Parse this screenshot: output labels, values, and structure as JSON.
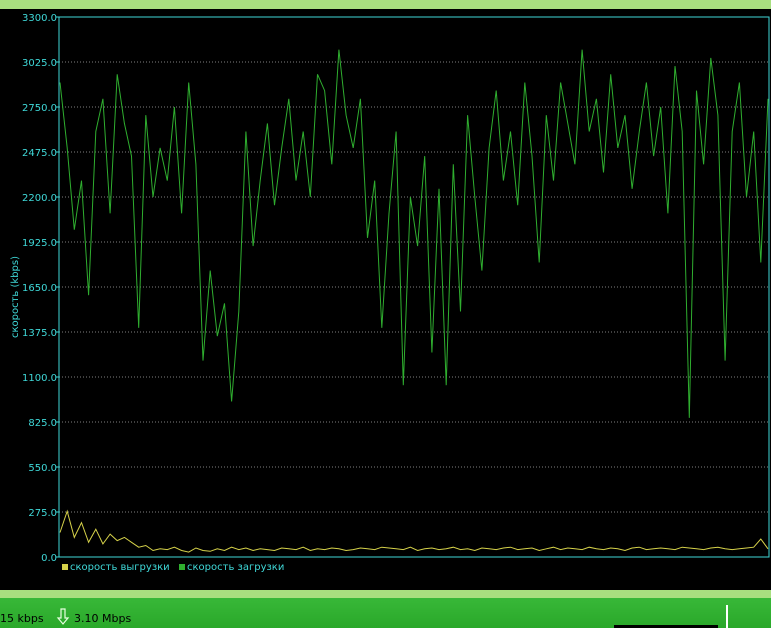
{
  "status_bar": {
    "upload_text": "15 kbps",
    "download_text": "3.10 Mbps",
    "download_icon": "arrow-down-icon"
  },
  "colors": {
    "background": "#000000",
    "axis": "#3fd8d8",
    "grid": "#7f7f7f",
    "upload_series": "#d6d24a",
    "download_series": "#2fae2f",
    "separator": "#a8df7f",
    "status_bar": "#2aa82a"
  },
  "chart_data": {
    "type": "line",
    "xlabel": "",
    "ylabel": "скорость (kbps)",
    "ylim": [
      0,
      3300
    ],
    "yticks": [
      0,
      275,
      550,
      825,
      1100,
      1375,
      1650,
      1925,
      2200,
      2475,
      2750,
      3025,
      3300
    ],
    "ytick_labels": [
      "0.0",
      "275.0",
      "550.0",
      "825.0",
      "1100.0",
      "1375.0",
      "1650.0",
      "1925.0",
      "2200.0",
      "2475.0",
      "2750.0",
      "3025.0",
      "3300.0"
    ],
    "grid": true,
    "legend_position": "bottom-left",
    "series": [
      {
        "name": "скорость выгрузки",
        "color": "#d6d24a",
        "values": [
          150,
          280,
          120,
          210,
          90,
          170,
          80,
          140,
          100,
          120,
          90,
          60,
          70,
          40,
          50,
          45,
          60,
          40,
          30,
          55,
          40,
          35,
          50,
          40,
          60,
          45,
          55,
          40,
          50,
          45,
          40,
          55,
          50,
          45,
          60,
          40,
          50,
          45,
          55,
          50,
          40,
          45,
          55,
          50,
          45,
          60,
          55,
          50,
          45,
          60,
          40,
          50,
          55,
          45,
          50,
          60,
          45,
          50,
          40,
          55,
          50,
          45,
          55,
          60,
          45,
          50,
          55,
          40,
          50,
          60,
          45,
          55,
          50,
          45,
          60,
          50,
          45,
          55,
          50,
          40,
          55,
          60,
          45,
          50,
          55,
          50,
          45,
          60,
          55,
          50,
          45,
          55,
          60,
          50,
          45,
          50,
          55,
          60,
          110,
          50
        ]
      },
      {
        "name": "скорость загрузки",
        "color": "#2fae2f",
        "values": [
          2900,
          2500,
          2000,
          2300,
          1600,
          2600,
          2800,
          2100,
          2950,
          2650,
          2450,
          1400,
          2700,
          2200,
          2500,
          2300,
          2750,
          2100,
          2900,
          2400,
          1200,
          1750,
          1350,
          1550,
          950,
          1500,
          2600,
          1900,
          2300,
          2650,
          2150,
          2500,
          2800,
          2300,
          2600,
          2200,
          2950,
          2850,
          2400,
          3100,
          2700,
          2500,
          2800,
          1950,
          2300,
          1400,
          2100,
          2600,
          1050,
          2200,
          1900,
          2450,
          1250,
          2250,
          1050,
          2400,
          1500,
          2700,
          2200,
          1750,
          2500,
          2850,
          2300,
          2600,
          2150,
          2900,
          2450,
          1800,
          2700,
          2300,
          2900,
          2650,
          2400,
          3100,
          2600,
          2800,
          2350,
          2950,
          2500,
          2700,
          2250,
          2600,
          2900,
          2450,
          2750,
          2100,
          3000,
          2600,
          850,
          2850,
          2400,
          3050,
          2700,
          1200,
          2600,
          2900,
          2200,
          2600,
          1800,
          2800
        ]
      }
    ]
  }
}
